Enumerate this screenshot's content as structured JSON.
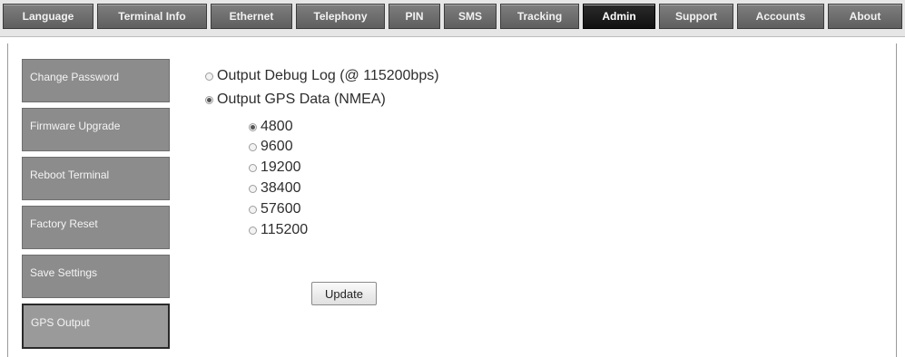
{
  "nav": {
    "tabs": [
      {
        "label": "Language",
        "active": false
      },
      {
        "label": "Terminal Info",
        "active": false
      },
      {
        "label": "Ethernet",
        "active": false
      },
      {
        "label": "Telephony",
        "active": false
      },
      {
        "label": "PIN",
        "active": false
      },
      {
        "label": "SMS",
        "active": false
      },
      {
        "label": "Tracking",
        "active": false
      },
      {
        "label": "Admin",
        "active": true
      },
      {
        "label": "Support",
        "active": false
      },
      {
        "label": "Accounts",
        "active": false
      },
      {
        "label": "About",
        "active": false
      }
    ]
  },
  "sidebar": {
    "items": [
      {
        "label": "Change Password",
        "active": false
      },
      {
        "label": "Firmware Upgrade",
        "active": false
      },
      {
        "label": "Reboot Terminal",
        "active": false
      },
      {
        "label": "Factory Reset",
        "active": false
      },
      {
        "label": "Save Settings",
        "active": false
      },
      {
        "label": "GPS Output",
        "active": true
      }
    ]
  },
  "output_mode": {
    "options": [
      {
        "label": "Output Debug Log (@ 115200bps)",
        "selected": false
      },
      {
        "label": "Output GPS Data (NMEA)",
        "selected": true
      }
    ]
  },
  "baud_rate": {
    "options": [
      {
        "label": "4800",
        "selected": true
      },
      {
        "label": "9600",
        "selected": false
      },
      {
        "label": "19200",
        "selected": false
      },
      {
        "label": "38400",
        "selected": false
      },
      {
        "label": "57600",
        "selected": false
      },
      {
        "label": "115200",
        "selected": false
      }
    ]
  },
  "update_label": "Update"
}
